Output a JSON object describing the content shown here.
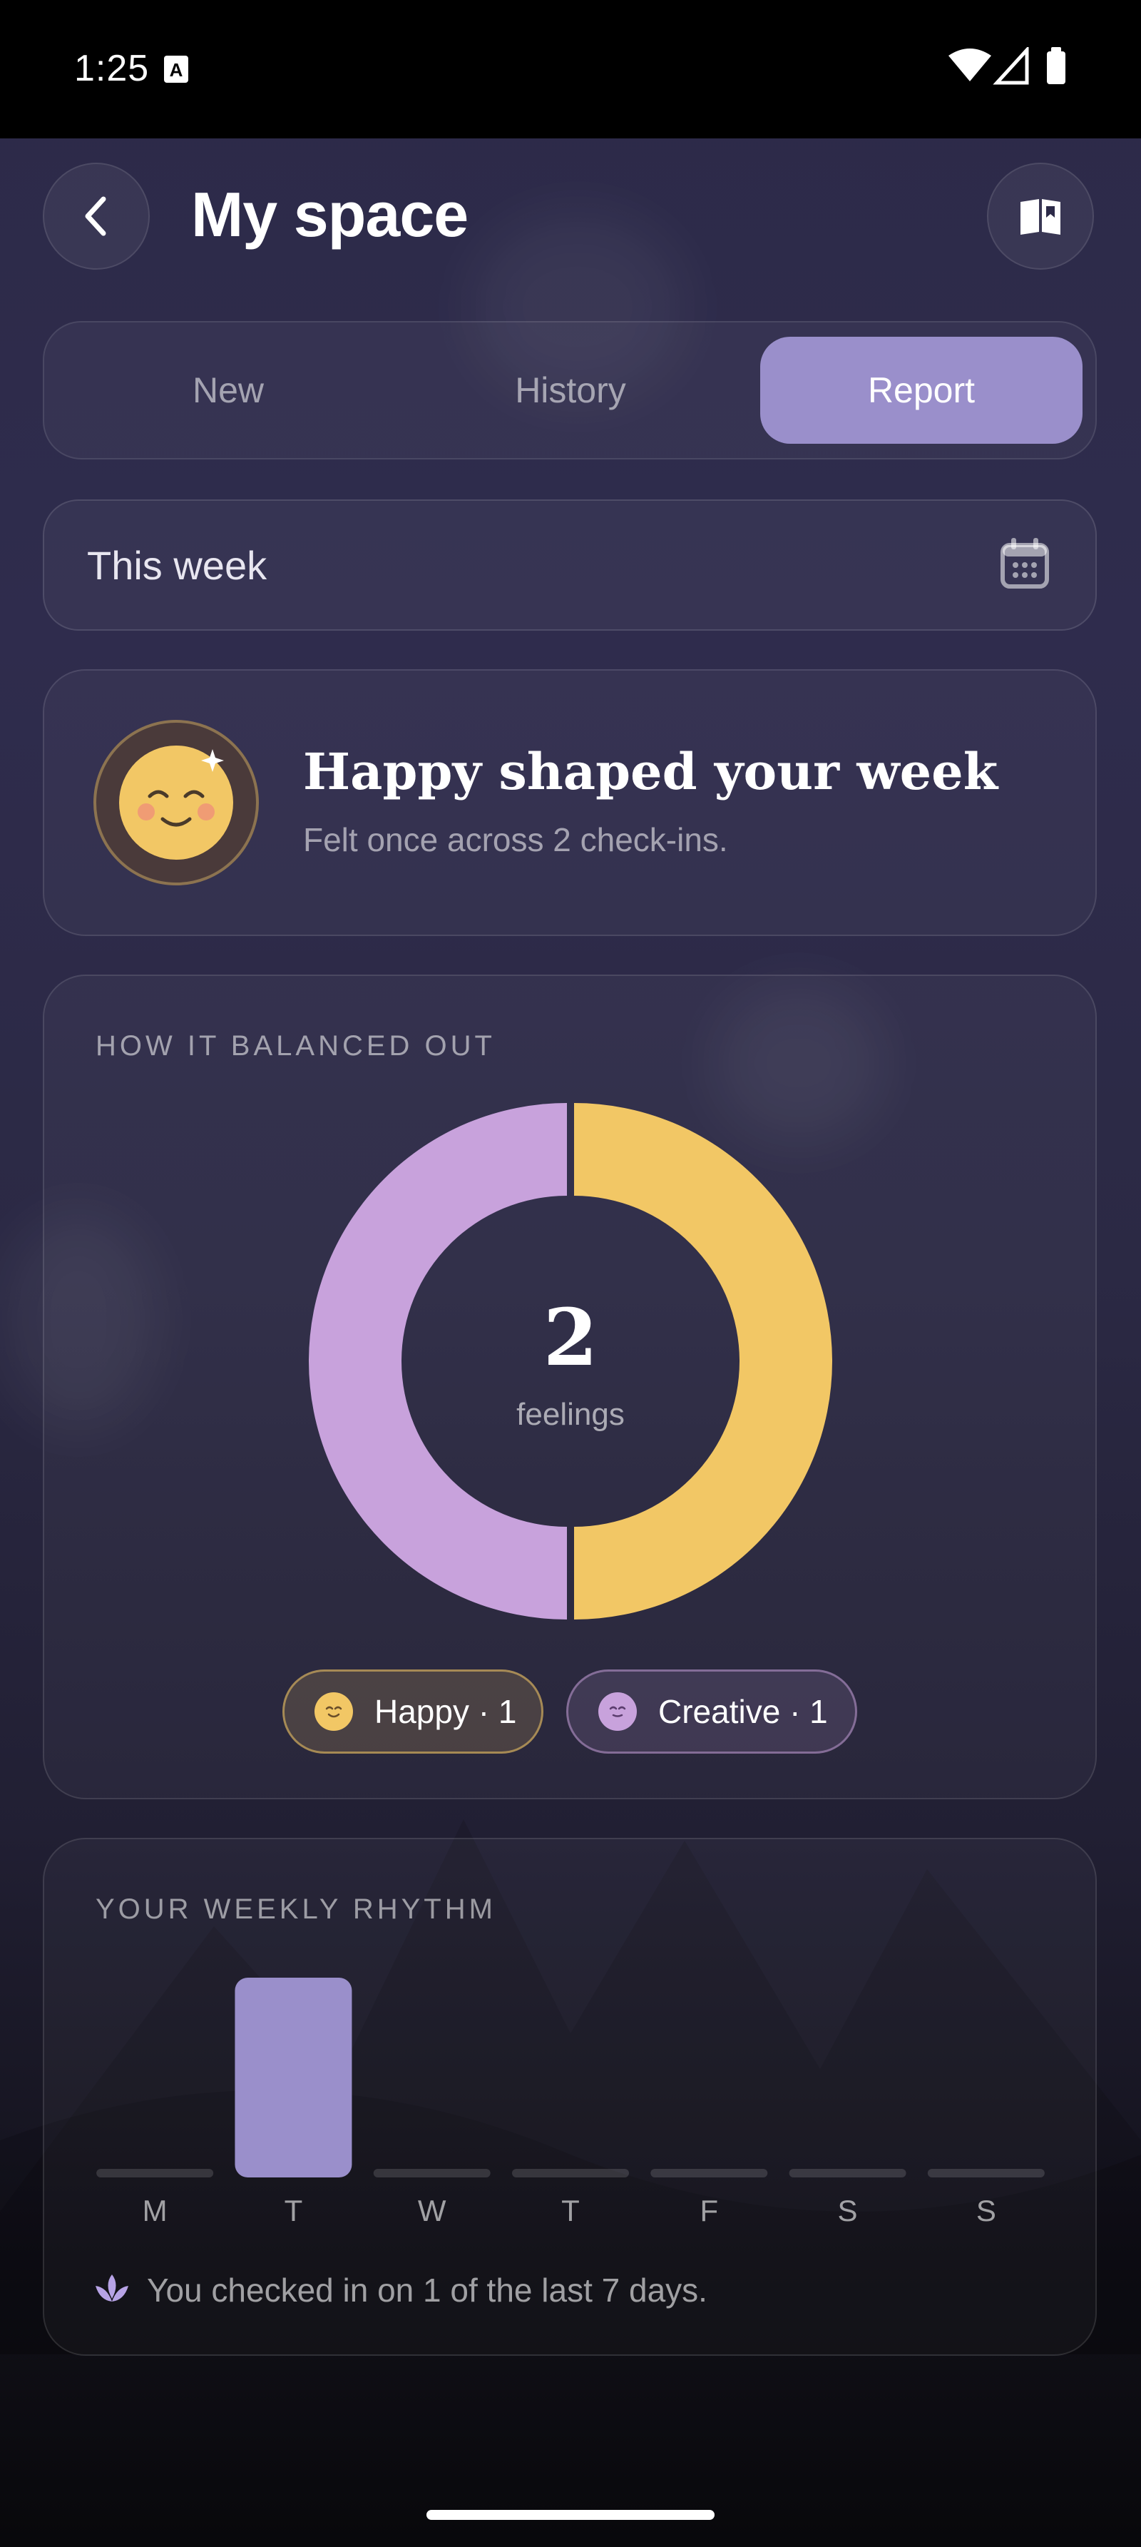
{
  "status_bar": {
    "time": "1:25",
    "badge": "A"
  },
  "header": {
    "title": "My space",
    "back_icon": "chevron-left-icon",
    "journal_icon": "book-icon"
  },
  "tabs": [
    {
      "label": "New",
      "active": false
    },
    {
      "label": "History",
      "active": false
    },
    {
      "label": "Report",
      "active": true
    }
  ],
  "date_filter": {
    "label": "This week",
    "icon": "calendar-icon"
  },
  "summary": {
    "title": "Happy shaped your week",
    "subtitle": "Felt once across 2 check-ins.",
    "emoji": "happy-face-icon"
  },
  "balance": {
    "section_label": "HOW IT BALANCED OUT",
    "total": "2",
    "total_label": "feelings",
    "legend": [
      {
        "label": "Happy · 1",
        "color": "#f2c765"
      },
      {
        "label": "Creative · 1",
        "color": "#c8a2dc"
      }
    ]
  },
  "rhythm": {
    "section_label": "YOUR WEEKLY RHYTHM",
    "days": [
      "M",
      "T",
      "W",
      "T",
      "F",
      "S",
      "S"
    ],
    "footer": "You checked in on 1 of the last 7 days."
  },
  "chart_data": [
    {
      "type": "pie",
      "labels": [
        "Happy",
        "Creative"
      ],
      "values": [
        1,
        1
      ],
      "colors": [
        "#f2c765",
        "#c8a2dc"
      ],
      "center_text": "2",
      "center_subtext": "feelings"
    },
    {
      "type": "bar",
      "categories": [
        "M",
        "T",
        "W",
        "T",
        "F",
        "S",
        "S"
      ],
      "values": [
        0,
        1,
        0,
        0,
        0,
        0,
        0
      ],
      "ylim": [
        0,
        1
      ]
    }
  ],
  "colors": {
    "accent": "#9a8fcb",
    "happy": "#f2c765",
    "creative": "#c8a2dc",
    "background": "#2c2a48"
  }
}
